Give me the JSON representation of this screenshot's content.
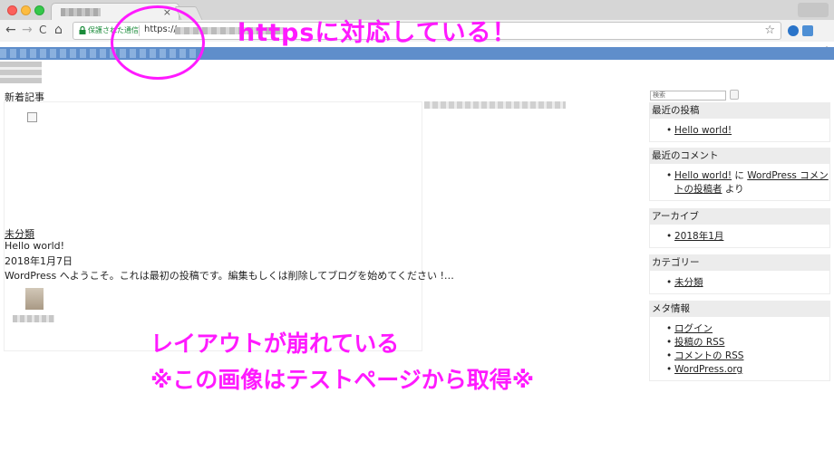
{
  "browser": {
    "tab_close": "×",
    "nav": {
      "back": "←",
      "forward": "→",
      "reload": "C",
      "home": "⌂"
    },
    "security_label": "保護された通信",
    "url_prefix": "https://",
    "star": "☆",
    "menu": "⋮"
  },
  "page": {
    "new_posts_heading": "新着記事",
    "post": {
      "category": "未分類",
      "title": "Hello world!",
      "date": "2018年1月7日",
      "excerpt": "WordPress へようこそ。これは最初の投稿です。編集もしくは削除してブログを始めてください !…"
    }
  },
  "sidebar": {
    "search_placeholder": "検索",
    "recent_posts": {
      "title": "最近の投稿",
      "items": [
        "Hello world!"
      ]
    },
    "recent_comments": {
      "title": "最近のコメント",
      "post_link": "Hello world!",
      "connector": " に ",
      "author_link": "WordPress コメントの投稿者",
      "suffix": " より"
    },
    "archives": {
      "title": "アーカイブ",
      "items": [
        "2018年1月"
      ]
    },
    "categories": {
      "title": "カテゴリー",
      "items": [
        "未分類"
      ]
    },
    "meta": {
      "title": "メタ情報",
      "items": [
        "ログイン",
        "投稿の RSS",
        "コメントの RSS",
        "WordPress.org"
      ]
    }
  },
  "annotations": {
    "https_note": "httpsに対応している！",
    "layout_broken": "レイアウトが崩れている",
    "test_page_note": "※この画像はテストページから取得※"
  },
  "colors": {
    "annotation": "#ff1aff",
    "header_bar": "#5f8ecb",
    "secure_green": "#1a8b3a"
  }
}
